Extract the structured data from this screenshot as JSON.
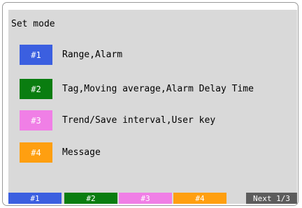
{
  "title": "Set mode",
  "modes": [
    {
      "key": "#1",
      "label": "Range,Alarm",
      "color": "#3b5fe0"
    },
    {
      "key": "#2",
      "label": "Tag,Moving average,Alarm Delay Time",
      "color": "#0a7d10"
    },
    {
      "key": "#3",
      "label": "Trend/Save interval,User key",
      "color": "#f07fe6"
    },
    {
      "key": "#4",
      "label": "Message",
      "color": "#ff9f10"
    }
  ],
  "softkeys": [
    {
      "label": "#1",
      "color": "#3b5fe0"
    },
    {
      "label": "#2",
      "color": "#0a7d10"
    },
    {
      "label": "#3",
      "color": "#f07fe6"
    },
    {
      "label": "#4",
      "color": "#ff9f10"
    },
    {
      "label": "Next 1/3",
      "color": "#5c5c5c"
    }
  ],
  "colors": {
    "screen_bg": "#d9d9d9",
    "frame": "#9a9a9a"
  }
}
